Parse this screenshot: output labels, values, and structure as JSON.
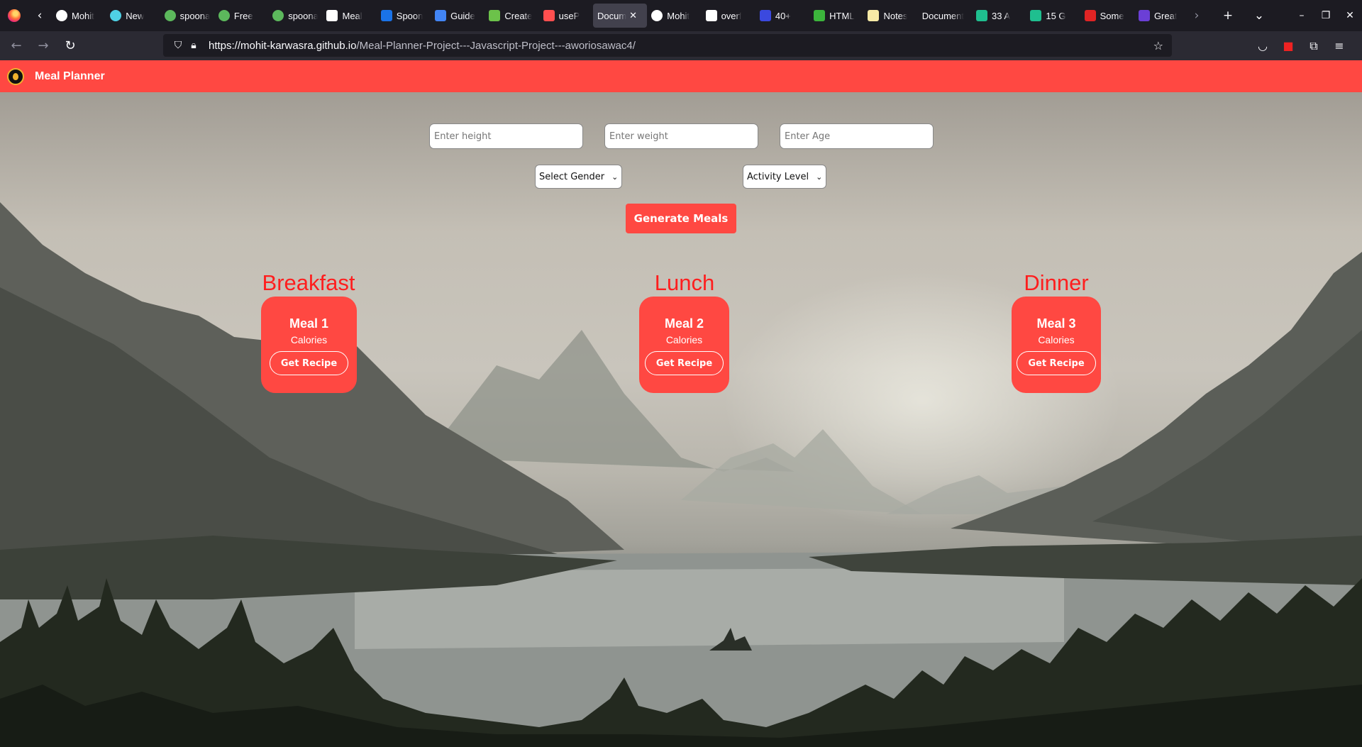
{
  "browser": {
    "tabs": [
      {
        "title": "Mohit",
        "icon": "github-icon",
        "color": "#ffffff"
      },
      {
        "title": "New",
        "icon": "nebula-icon",
        "color": "#4fd1e5"
      },
      {
        "title": "spoonacular",
        "icon": "spoonacular-icon",
        "color": "#5cb85c"
      },
      {
        "title": "Free",
        "icon": "spoonacular-icon",
        "color": "#5cb85c"
      },
      {
        "title": "spoonacular",
        "icon": "spoonacular-icon",
        "color": "#5cb85c"
      },
      {
        "title": "Meal",
        "icon": "notion-icon",
        "color": "#ffffff"
      },
      {
        "title": "Spoon",
        "icon": "search-logo-icon",
        "color": "#1a73e8"
      },
      {
        "title": "Guide",
        "icon": "docs-icon",
        "color": "#4285f4"
      },
      {
        "title": "Create",
        "icon": "leaf-icon",
        "color": "#6cc24a"
      },
      {
        "title": "useP",
        "icon": "dots-icon",
        "color": "#ff4f4f"
      },
      {
        "title": "Docum",
        "icon": "none",
        "color": "#000000",
        "active": true
      },
      {
        "title": "Mohit",
        "icon": "github-icon",
        "color": "#ffffff"
      },
      {
        "title": "overf",
        "icon": "medium-icon",
        "color": "#ffffff"
      },
      {
        "title": "40+",
        "icon": "dev-icon",
        "color": "#3b49df"
      },
      {
        "title": "HTML",
        "icon": "h-icon",
        "color": "#3cb43c"
      },
      {
        "title": "Notes",
        "icon": "note-icon",
        "color": "#f6e9a6"
      },
      {
        "title": "Document",
        "icon": "none",
        "color": "#000000"
      },
      {
        "title": "33 A",
        "icon": "sheet-icon",
        "color": "#1fbf8f"
      },
      {
        "title": "15 G",
        "icon": "sheet-icon",
        "color": "#1fbf8f"
      },
      {
        "title": "Some",
        "icon": "red-icon",
        "color": "#e02424"
      },
      {
        "title": "Great",
        "icon": "six-icon",
        "color": "#6b3fd6"
      }
    ],
    "url_host": "https://mohit-karwasra.github.io",
    "url_path": "/Meal-Planner-Project---Javascript-Project---aworiosawac4/"
  },
  "app": {
    "title": "Meal Planner",
    "height_placeholder": "Enter height",
    "weight_placeholder": "Enter weight",
    "age_placeholder": "Enter Age",
    "gender_select": "Select Gender",
    "activity_select": "Activity Level",
    "generate_label": "Generate Meals",
    "accent": "#ff4842",
    "heading_color": "#ff1e1e"
  },
  "meals": [
    {
      "heading": "Breakfast",
      "name": "Meal 1",
      "calories": "Calories",
      "button": "Get Recipe"
    },
    {
      "heading": "Lunch",
      "name": "Meal 2",
      "calories": "Calories",
      "button": "Get Recipe"
    },
    {
      "heading": "Dinner",
      "name": "Meal 3",
      "calories": "Calories",
      "button": "Get Recipe"
    }
  ]
}
